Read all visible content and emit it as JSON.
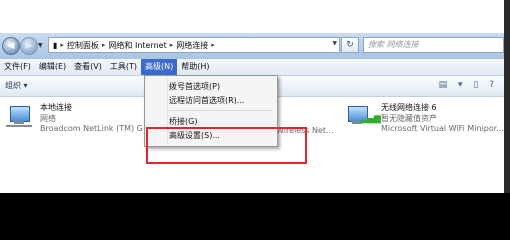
{
  "address_bar": {
    "crumbs": [
      "控制面板",
      "网络和 Internet",
      "网络连接"
    ],
    "search_placeholder": "搜索 网络连接"
  },
  "menu": {
    "items": [
      "文件(F)",
      "编辑(E)",
      "查看(V)",
      "工具(T)",
      "高级(N)",
      "帮助(H)"
    ],
    "active_index": 4
  },
  "toolbar": {
    "organize": "组织 ▾"
  },
  "connections": [
    {
      "name": "本地连接",
      "status": "网络",
      "device": "Broadcom NetLink (TM) G"
    },
    {
      "name": "无线网络连接 6",
      "status": "暂无隐藏值资产",
      "device": "Microsoft Virtual WiFi Minipor..."
    }
  ],
  "partial_device_text": "Wireless Net...",
  "dropdown": {
    "items": [
      "拨号首选项(P)",
      "远程访问首选项(R)...",
      "桥接(G)",
      "高级设置(S)..."
    ]
  },
  "colors": {
    "menu_active": "#3c6bc8",
    "highlight": "#e0262a"
  }
}
